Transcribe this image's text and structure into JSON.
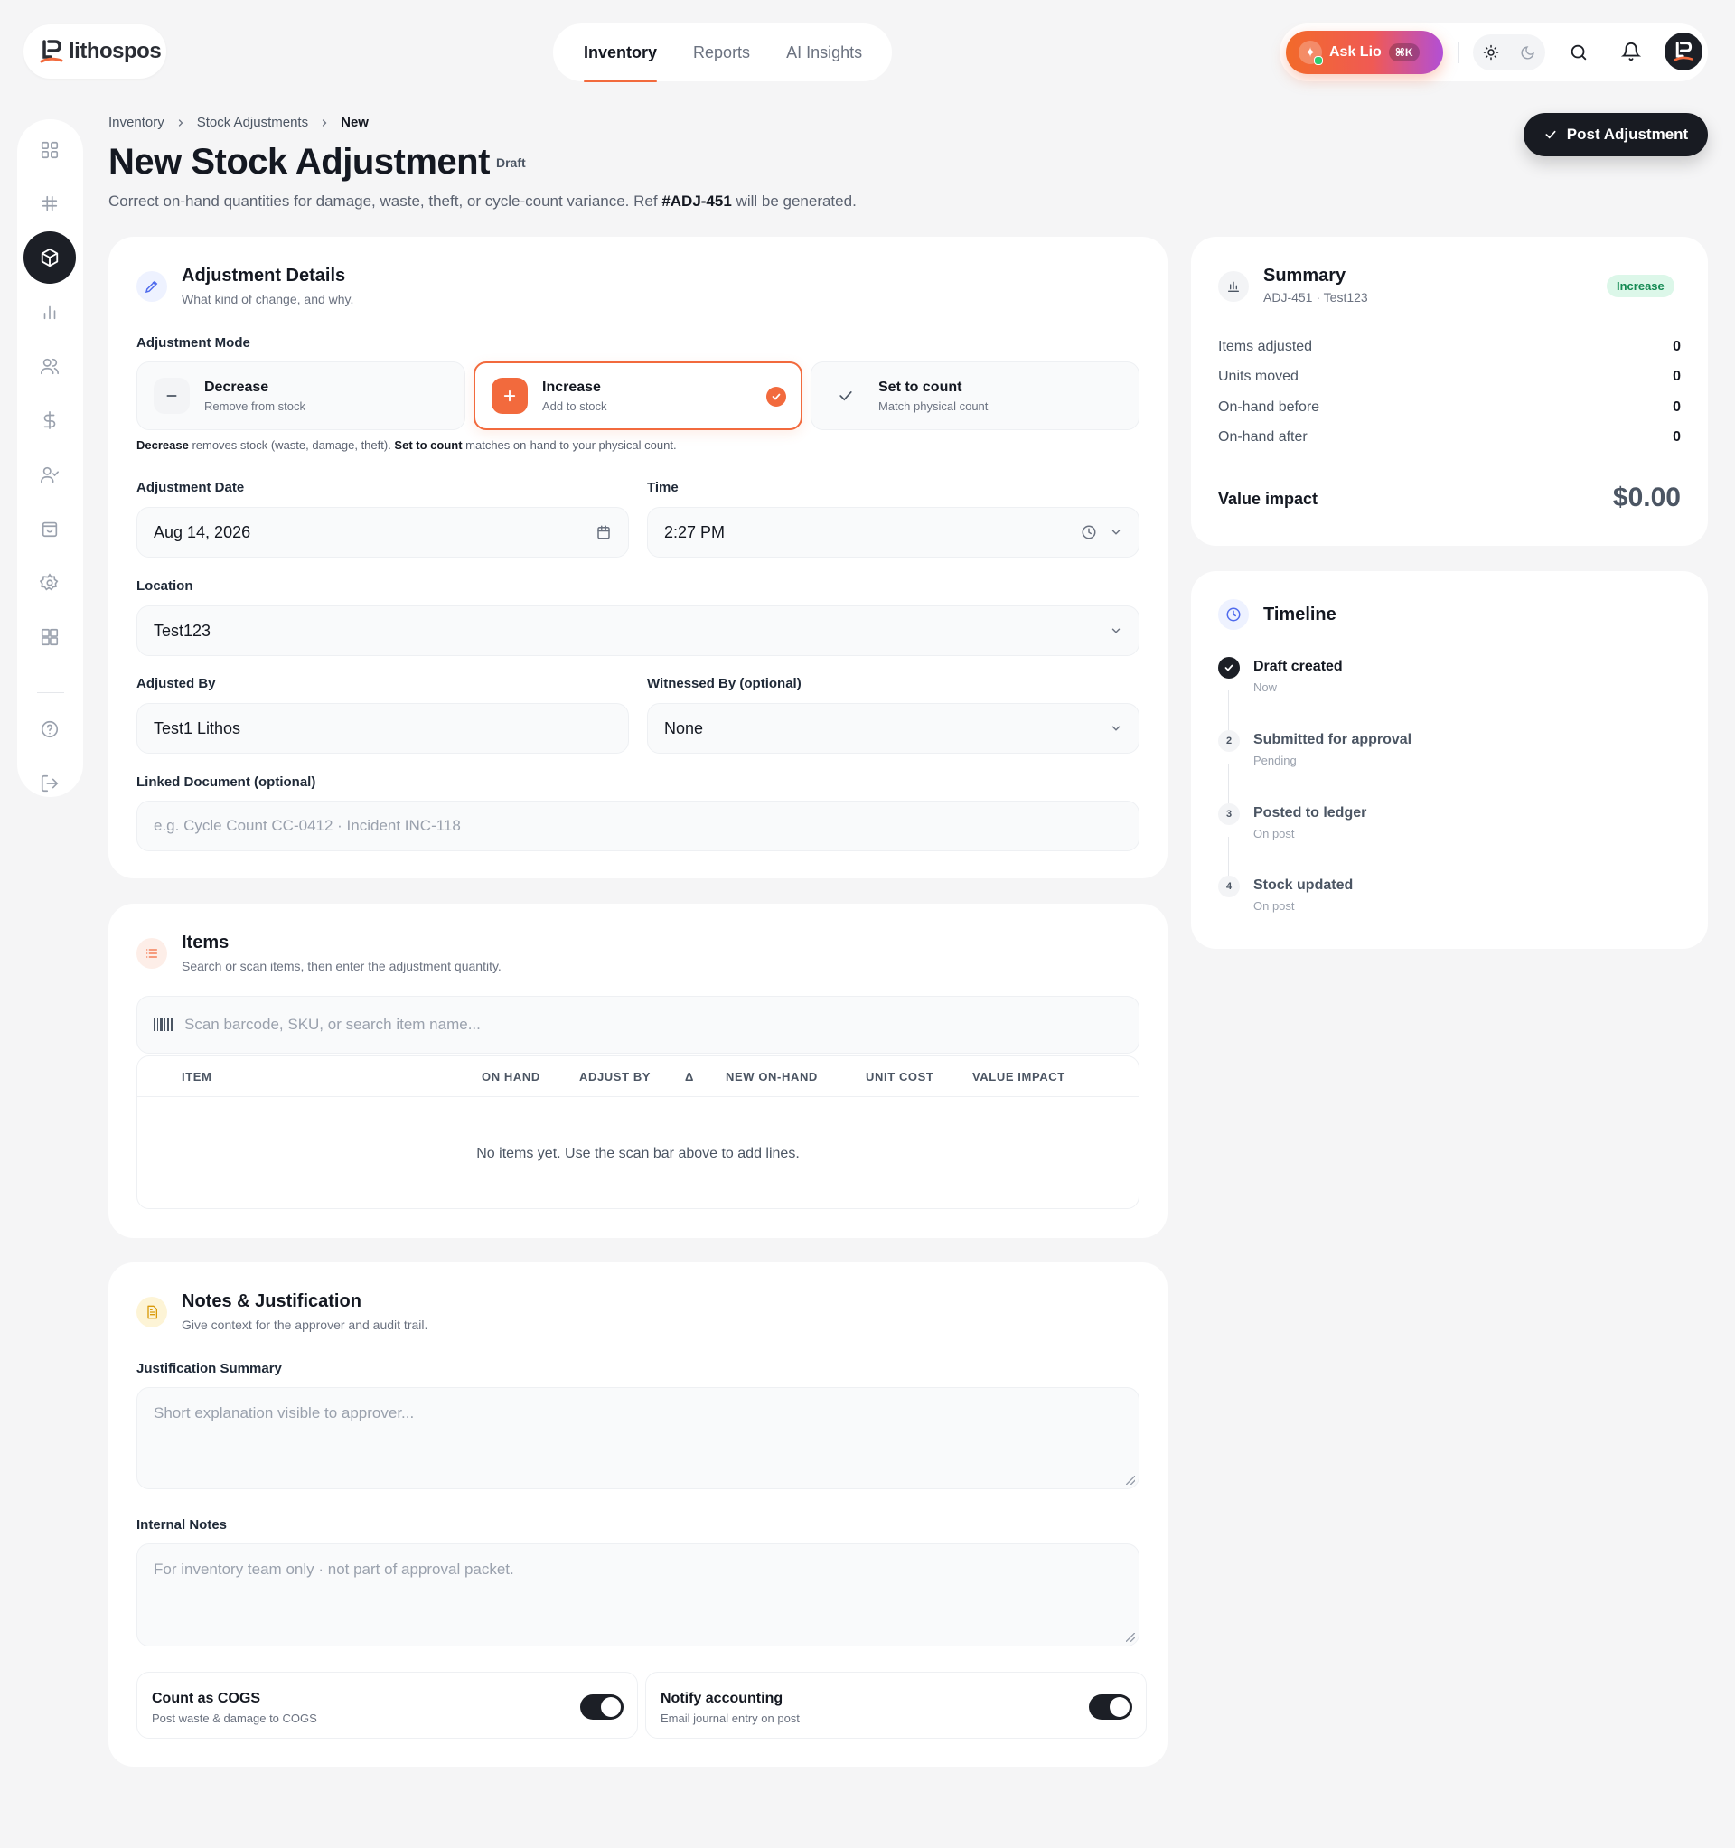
{
  "brand": {
    "name": "lithospos"
  },
  "nav": {
    "tabs": [
      {
        "label": "Inventory"
      },
      {
        "label": "Reports"
      },
      {
        "label": "AI Insights"
      }
    ]
  },
  "topbar": {
    "ask_label": "Ask Lio",
    "ask_shortcut": "⌘K"
  },
  "breadcrumb": {
    "items": [
      "Inventory",
      "Stock Adjustments",
      "New"
    ]
  },
  "header": {
    "title": "New Stock Adjustment",
    "status": "Draft",
    "subtitle_pre": "Correct on-hand quantities for damage, waste, theft, or cycle-count variance. Ref ",
    "ref": "#ADJ-451",
    "subtitle_post": " will be generated.",
    "post_button": "Post Adjustment"
  },
  "details": {
    "title": "Adjustment Details",
    "subtitle": "What kind of change, and why.",
    "mode_label": "Adjustment Mode",
    "modes": [
      {
        "title": "Decrease",
        "sub": "Remove from stock"
      },
      {
        "title": "Increase",
        "sub": "Add to stock",
        "selected": true
      },
      {
        "title": "Set to count",
        "sub": "Match physical count"
      }
    ],
    "mode_help": {
      "b1": "Decrease",
      "t1": " removes stock (waste, damage, theft). ",
      "b2": "Set to count",
      "t2": " matches on-hand to your physical count."
    },
    "date_label": "Adjustment Date",
    "date_value": "Aug 14, 2026",
    "time_label": "Time",
    "time_value": "2:27 PM",
    "location_label": "Location",
    "location_value": "Test123",
    "adjusted_by_label": "Adjusted By",
    "adjusted_by_value": "Test1 Lithos",
    "witness_label": "Witnessed By (optional)",
    "witness_value": "None",
    "linked_label": "Linked Document (optional)",
    "linked_placeholder": "e.g. Cycle Count CC-0412 · Incident INC-118"
  },
  "items": {
    "title": "Items",
    "subtitle": "Search or scan items, then enter the adjustment quantity.",
    "scan_placeholder": "Scan barcode, SKU, or search item name...",
    "columns": [
      "ITEM",
      "ON HAND",
      "ADJUST BY",
      "Δ",
      "NEW ON-HAND",
      "UNIT COST",
      "VALUE IMPACT"
    ],
    "empty": "No items yet. Use the scan bar above to add lines."
  },
  "notes": {
    "title": "Notes & Justification",
    "subtitle": "Give context for the approver and audit trail.",
    "summary_label": "Justification Summary",
    "summary_placeholder": "Short explanation visible to approver...",
    "internal_label": "Internal Notes",
    "internal_placeholder": "For inventory team only · not part of approval packet.",
    "toggles": [
      {
        "title": "Count as COGS",
        "sub": "Post waste & damage to COGS",
        "on": true
      },
      {
        "title": "Notify accounting",
        "sub": "Email journal entry on post",
        "on": true
      }
    ]
  },
  "summary": {
    "title": "Summary",
    "sub": "ADJ-451 · Test123",
    "badge": "Increase",
    "rows": [
      {
        "label": "Items adjusted",
        "value": "0"
      },
      {
        "label": "Units moved",
        "value": "0"
      },
      {
        "label": "On-hand before",
        "value": "0"
      },
      {
        "label": "On-hand after",
        "value": "0"
      }
    ],
    "value_label": "Value impact",
    "value": "$0.00"
  },
  "timeline": {
    "title": "Timeline",
    "steps": [
      {
        "marker": "",
        "title": "Draft created",
        "sub": "Now",
        "done": true
      },
      {
        "marker": "2",
        "title": "Submitted for approval",
        "sub": "Pending"
      },
      {
        "marker": "3",
        "title": "Posted to ledger",
        "sub": "On post"
      },
      {
        "marker": "4",
        "title": "Stock updated",
        "sub": "On post"
      }
    ]
  },
  "colors": {
    "accent": "#f26a3d",
    "dark": "#1c1f26",
    "success_bg": "#dcf7e9",
    "success_text": "#148a53"
  }
}
